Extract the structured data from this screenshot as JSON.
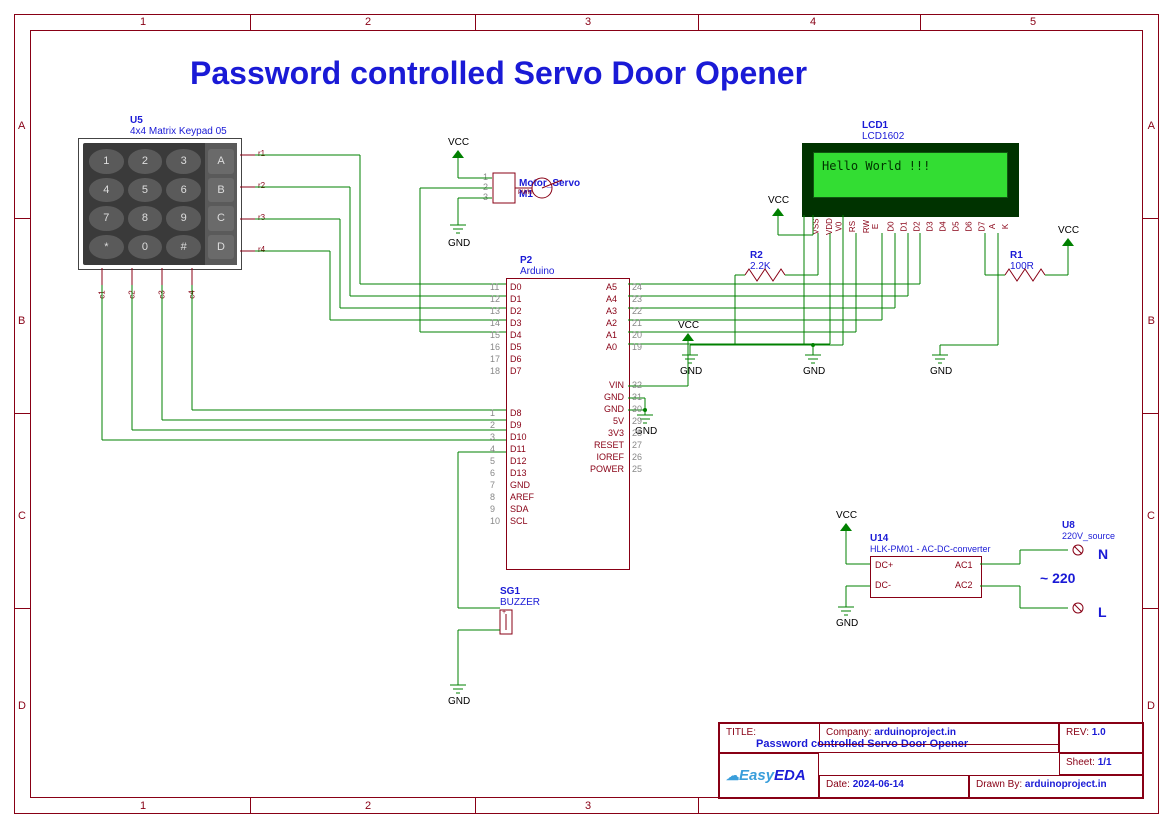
{
  "page_title": "Password controlled Servo Door Opener",
  "frame": {
    "cols": [
      "1",
      "2",
      "3",
      "4",
      "5"
    ],
    "rows": [
      "A",
      "B",
      "C",
      "D"
    ]
  },
  "keypad": {
    "ref": "U5",
    "name": "4x4 Matrix Keypad 05",
    "keys": [
      "1",
      "2",
      "3",
      "4",
      "5",
      "6",
      "7",
      "8",
      "9",
      "*",
      "0",
      "#"
    ],
    "side_keys": [
      "A",
      "B",
      "C",
      "D"
    ],
    "rows": [
      "r1",
      "r2",
      "r3",
      "r4"
    ],
    "cols": [
      "c1",
      "c2",
      "c3",
      "c4"
    ]
  },
  "servo": {
    "ref": "Motor_Servo",
    "name": "M1",
    "pins": [
      "1",
      "2",
      "3"
    ],
    "sig": "PWM",
    "vcc": "VCC",
    "gnd": "GND"
  },
  "arduino": {
    "ref": "P2",
    "name": "Arduino",
    "left": [
      {
        "n": "11",
        "l": "D0"
      },
      {
        "n": "12",
        "l": "D1"
      },
      {
        "n": "13",
        "l": "D2"
      },
      {
        "n": "14",
        "l": "D3"
      },
      {
        "n": "15",
        "l": "D4"
      },
      {
        "n": "16",
        "l": "D5"
      },
      {
        "n": "17",
        "l": "D6"
      },
      {
        "n": "18",
        "l": "D7"
      },
      {
        "n": "1",
        "l": "D8"
      },
      {
        "n": "2",
        "l": "D9"
      },
      {
        "n": "3",
        "l": "D10"
      },
      {
        "n": "4",
        "l": "D11"
      },
      {
        "n": "5",
        "l": "D12"
      },
      {
        "n": "6",
        "l": "D13"
      },
      {
        "n": "7",
        "l": "GND"
      },
      {
        "n": "8",
        "l": "AREF"
      },
      {
        "n": "9",
        "l": "SDA"
      },
      {
        "n": "10",
        "l": "SCL"
      }
    ],
    "right_a": [
      {
        "n": "24",
        "l": "A5"
      },
      {
        "n": "23",
        "l": "A4"
      },
      {
        "n": "22",
        "l": "A3"
      },
      {
        "n": "21",
        "l": "A2"
      },
      {
        "n": "20",
        "l": "A1"
      },
      {
        "n": "19",
        "l": "A0"
      }
    ],
    "right_p": [
      {
        "n": "32",
        "l": "VIN"
      },
      {
        "n": "31",
        "l": "GND"
      },
      {
        "n": "30",
        "l": "GND"
      },
      {
        "n": "29",
        "l": "5V"
      },
      {
        "n": "28",
        "l": "3V3"
      },
      {
        "n": "27",
        "l": "RESET"
      },
      {
        "n": "26",
        "l": "IOREF"
      },
      {
        "n": "25",
        "l": "POWER"
      }
    ]
  },
  "lcd": {
    "ref": "LCD1",
    "name": "LCD1602",
    "text": "Hello World !!!",
    "pins": [
      "VSS",
      "VDD",
      "V0",
      "RS",
      "RW",
      "E",
      "D0",
      "D1",
      "D2",
      "D3",
      "D4",
      "D5",
      "D6",
      "D7",
      "A",
      "K"
    ]
  },
  "buzzer": {
    "ref": "SG1",
    "name": "BUZZER"
  },
  "resistors": {
    "r1": {
      "ref": "R1",
      "val": "100R"
    },
    "r2": {
      "ref": "R2",
      "val": "2.2K"
    }
  },
  "converter": {
    "ref": "U14",
    "name": "HLK-PM01 - AC-DC-converter",
    "pins": [
      "DC+",
      "DC-",
      "AC1",
      "AC2"
    ]
  },
  "source": {
    "ref": "U8",
    "name": "220V_source",
    "n": "N",
    "l": "L",
    "volt": "&#126; 220"
  },
  "power": {
    "vcc": "VCC",
    "gnd": "GND"
  },
  "titleblock": {
    "title_hdr": "TITLE:",
    "title": "Password controlled Servo Door Opener",
    "rev_hdr": "REV:",
    "rev": "1.0",
    "company_hdr": "Company:",
    "company": "arduinoproject.in",
    "sheet_hdr": "Sheet:",
    "sheet": "1/1",
    "date_hdr": "Date:",
    "date": "2024-06-14",
    "drawn_hdr": "Drawn By:",
    "drawn": "arduinoproject.in",
    "logo": "EasyEDA"
  }
}
